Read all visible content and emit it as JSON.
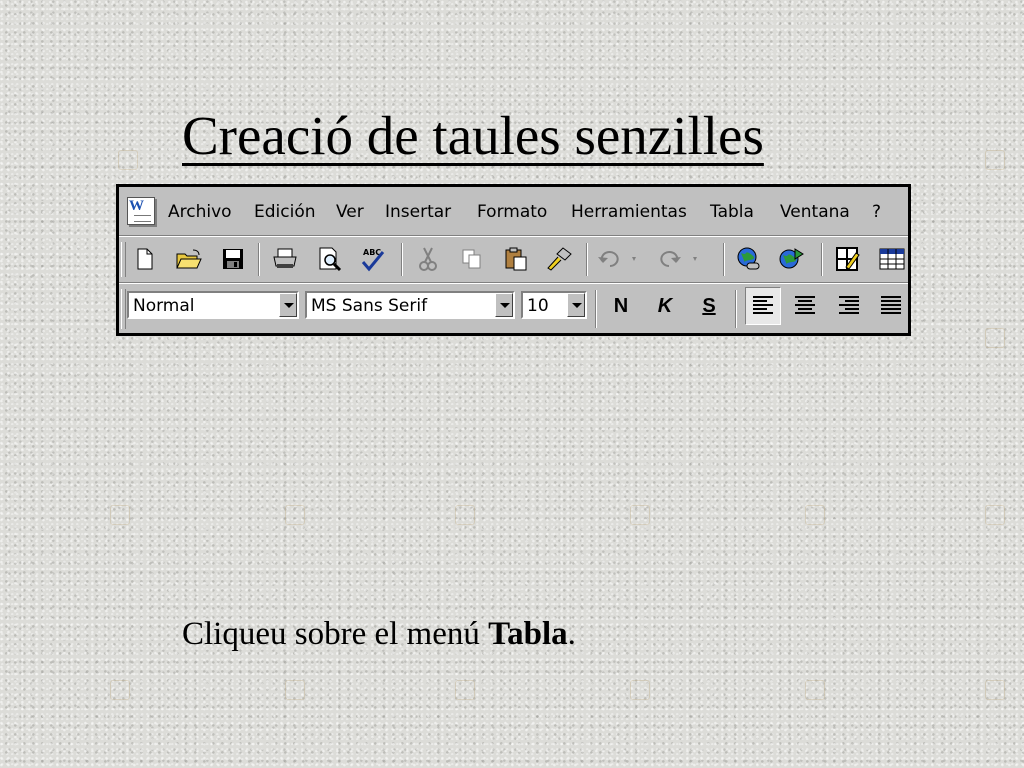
{
  "slide": {
    "title": "Creació de taules senzilles",
    "caption_prefix": "Cliqueu sobre el menú ",
    "caption_bold": "Tabla",
    "caption_suffix": "."
  },
  "word": {
    "menu": [
      "Archivo",
      "Edición",
      "Ver",
      "Insertar",
      "Formato",
      "Herramientas",
      "Tabla",
      "Ventana",
      "?"
    ],
    "format_bar": {
      "style_value": "Normal",
      "font_value": "MS Sans Serif",
      "size_value": "10",
      "bold_label": "N",
      "italic_label": "K",
      "underline_label": "S"
    },
    "standard_toolbar_icons": [
      "new-doc-icon",
      "open-folder-icon",
      "save-icon",
      "print-icon",
      "print-preview-icon",
      "spelling-icon",
      "cut-icon",
      "copy-icon",
      "paste-icon",
      "format-painter-icon",
      "undo-icon",
      "redo-icon",
      "insert-hyperlink-icon",
      "web-toolbar-icon",
      "tables-borders-icon",
      "insert-table-icon"
    ],
    "alignment_icons": [
      "align-left-icon",
      "align-center-icon",
      "align-right-icon",
      "justify-icon"
    ]
  }
}
